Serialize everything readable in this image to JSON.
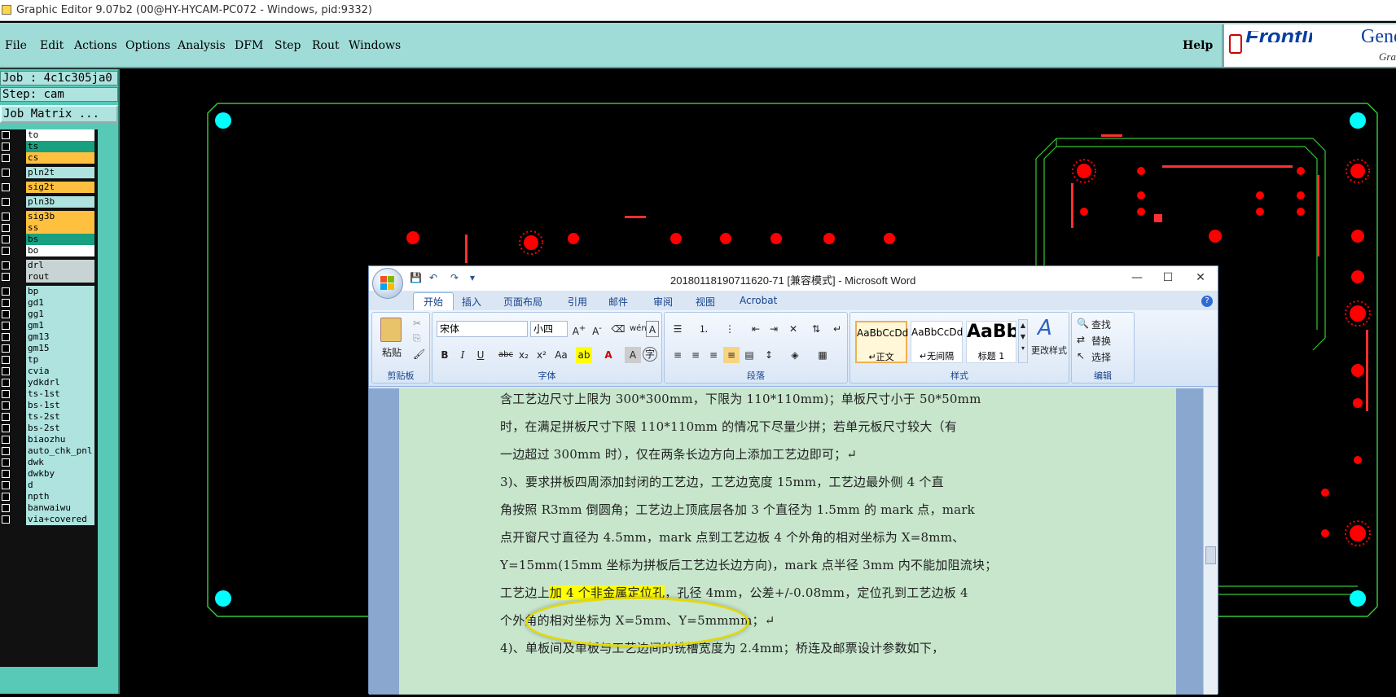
{
  "titlebar": {
    "title": "Graphic Editor 9.07b2 (00@HY-HYCAM-PC072 - Windows, pid:9332)"
  },
  "menu": {
    "items": [
      "File",
      "Edit",
      "Actions",
      "Options",
      "Analysis",
      "DFM",
      "Step",
      "Rout",
      "Windows"
    ],
    "help": "Help"
  },
  "logo": {
    "brand": "Frontline",
    "product": "Genes",
    "sub": "Gra"
  },
  "sidebar": {
    "job": "Job : 4c1c305ja0",
    "step": "Step: cam",
    "matrix": "Job Matrix ...",
    "layers": [
      {
        "name": "to",
        "color": "#ffffff"
      },
      {
        "name": "ts",
        "color": "#18a080"
      },
      {
        "name": "cs",
        "color": "#ffc040"
      },
      {
        "name": "pln2t",
        "color": "#aee3df"
      },
      {
        "name": "sig2t",
        "color": "#ffc040"
      },
      {
        "name": "pln3b",
        "color": "#aee3df"
      },
      {
        "name": "sig3b",
        "color": "#ffc040"
      },
      {
        "name": "ss",
        "color": "#ffc040"
      },
      {
        "name": "bs",
        "color": "#18a080"
      },
      {
        "name": "bo",
        "color": "#ffffff"
      },
      {
        "name": "drl",
        "color": "#c8d4d4"
      },
      {
        "name": "rout",
        "color": "#c8d4d4"
      },
      {
        "name": "bp",
        "color": "#aee3df"
      },
      {
        "name": "gd1",
        "color": "#aee3df"
      },
      {
        "name": "gg1",
        "color": "#aee3df"
      },
      {
        "name": "gm1",
        "color": "#aee3df"
      },
      {
        "name": "gm13",
        "color": "#aee3df"
      },
      {
        "name": "gm15",
        "color": "#aee3df"
      },
      {
        "name": "tp",
        "color": "#aee3df"
      },
      {
        "name": "cvia",
        "color": "#aee3df"
      },
      {
        "name": "ydkdrl",
        "color": "#aee3df"
      },
      {
        "name": "ts-1st",
        "color": "#aee3df"
      },
      {
        "name": "bs-1st",
        "color": "#aee3df"
      },
      {
        "name": "ts-2st",
        "color": "#aee3df"
      },
      {
        "name": "bs-2st",
        "color": "#aee3df"
      },
      {
        "name": "biaozhu",
        "color": "#aee3df"
      },
      {
        "name": "auto_chk_pnl",
        "color": "#aee3df"
      },
      {
        "name": "dwk",
        "color": "#aee3df"
      },
      {
        "name": "dwkby",
        "color": "#aee3df"
      },
      {
        "name": "d",
        "color": "#aee3df"
      },
      {
        "name": "npth",
        "color": "#aee3df"
      },
      {
        "name": "banwaiwu",
        "color": "#aee3df"
      },
      {
        "name": "via+covered",
        "color": "#aee3df"
      }
    ]
  },
  "word": {
    "qat": {
      "save": "💾",
      "undo": "↶",
      "redo": "↷",
      "more": "▾"
    },
    "title": "20180118190711620-71 [兼容模式] - Microsoft Word",
    "controls": {
      "min": "—",
      "max": "☐",
      "close": "✕"
    },
    "help": "?",
    "tabs": [
      "开始",
      "插入",
      "页面布局",
      "引用",
      "邮件",
      "审阅",
      "视图",
      "Acrobat"
    ],
    "ribbon": {
      "clipboard": {
        "label": "剪贴板",
        "paste": "粘贴"
      },
      "font": {
        "label": "字体",
        "name": "宋体",
        "size": "小四"
      },
      "paragraph": {
        "label": "段落"
      },
      "styles": {
        "label": "样式",
        "items": [
          {
            "sample": "AaBbCcDd",
            "name": "↵正文"
          },
          {
            "sample": "AaBbCcDd",
            "name": "↵无间隔"
          },
          {
            "sample": "AaBb",
            "name": "标题 1"
          }
        ],
        "change": "更改样式"
      },
      "editing": {
        "label": "编辑",
        "find": "查找",
        "replace": "替换",
        "select": "选择"
      }
    },
    "doc": {
      "line1": "含工艺边尺寸上限为 300*300mm，下限为 110*110mm)；单板尺寸小于 50*50mm",
      "line2": "时，在满足拼板尺寸下限 110*110mm 的情况下尽量少拼；若单元板尺寸较大（有",
      "line3": "一边超过 300mm 时），仅在两条长边方向上添加工艺边即可；↵",
      "line4": "3)、要求拼板四周添加封闭的工艺边，工艺边宽度 15mm，工艺边最外侧 4 个直",
      "line5": "角按照 R3mm 倒圆角；工艺边上顶底层各加 3 个直径为 1.5mm 的 mark 点，mark",
      "line6": "点开窗尺寸直径为 4.5mm，mark 点到工艺边板 4 个外角的相对坐标为 X=8mm、",
      "line7": "Y=15mm(15mm 坐标为拼板后工艺边长边方向)，mark 点半径 3mm 内不能加阻流块；",
      "line8a": "工艺边上",
      "line8b": "加 4 个非金属定位孔",
      "line8c": "，孔径 4mm，公差+/-0.08mm，定位孔到工艺边板 4",
      "line9": "个外角的相对坐标为 X=5mm、Y=5mmmm；↵",
      "line10": "4)、单板间及单板与工艺边间的铣槽宽度为 2.4mm；桥连及邮票设计参数如下，"
    }
  },
  "colors": {
    "outline": "#35c435",
    "pad": "#ff0000",
    "fiducial": "#00ffff",
    "panel": "#57c9b6"
  }
}
